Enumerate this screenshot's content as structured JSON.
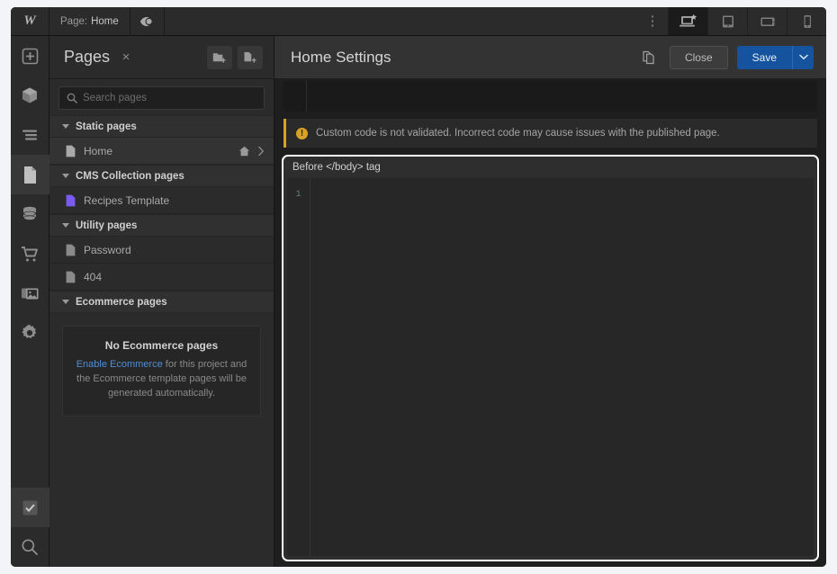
{
  "topbar": {
    "logo": "W",
    "page_prefix": "Page:",
    "page_name": "Home",
    "preview_icon": "eye-icon",
    "menu_icon": "three-dots-icon",
    "devices": [
      {
        "name": "desktop",
        "label": "Desktop",
        "active": true
      },
      {
        "name": "tablet",
        "label": "Tablet",
        "active": false
      },
      {
        "name": "tablet-landscape",
        "label": "Tablet landscape",
        "active": false
      },
      {
        "name": "mobile",
        "label": "Mobile",
        "active": false
      }
    ]
  },
  "rail": {
    "items": [
      {
        "name": "add-elements",
        "icon": "plus-box-icon",
        "selected": false
      },
      {
        "name": "components",
        "icon": "cube-icon",
        "selected": false
      },
      {
        "name": "navigator",
        "icon": "layers-lines-icon",
        "selected": false
      },
      {
        "name": "pages",
        "icon": "page-document-icon",
        "selected": true
      },
      {
        "name": "cms",
        "icon": "database-icon",
        "selected": false
      },
      {
        "name": "ecommerce",
        "icon": "shopping-cart-icon",
        "selected": false
      },
      {
        "name": "assets",
        "icon": "images-icon",
        "selected": false
      },
      {
        "name": "settings",
        "icon": "gear-icon",
        "selected": false
      }
    ],
    "bottom_items": [
      {
        "name": "audit",
        "icon": "checkbox-check-icon",
        "selected": true
      },
      {
        "name": "search",
        "icon": "magnifier-icon",
        "selected": false
      }
    ]
  },
  "pages_panel": {
    "title": "Pages",
    "close_label": "×",
    "new_folder_icon": "new-folder-icon",
    "new_page_icon": "new-page-icon",
    "search_placeholder": "Search pages",
    "search_value": "",
    "groups": [
      {
        "label": "Static pages",
        "items": [
          {
            "name": "Home",
            "icon": "page-icon",
            "active": true,
            "home": true,
            "chevron": true,
            "accent": "#a9a9a9"
          }
        ]
      },
      {
        "label": "CMS Collection pages",
        "items": [
          {
            "name": "Recipes Template",
            "icon": "page-icon",
            "active": false,
            "home": false,
            "chevron": false,
            "accent": "#7a5af0"
          }
        ]
      },
      {
        "label": "Utility pages",
        "items": [
          {
            "name": "Password",
            "icon": "page-icon",
            "active": false,
            "home": false,
            "chevron": false,
            "accent": "#8a8a8a"
          },
          {
            "name": "404",
            "icon": "page-icon",
            "active": false,
            "home": false,
            "chevron": false,
            "accent": "#8a8a8a"
          }
        ]
      },
      {
        "label": "Ecommerce pages",
        "items": []
      }
    ],
    "empty_state": {
      "title": "No Ecommerce pages",
      "link": "Enable Ecommerce",
      "text": " for this project and the Ecommerce template pages will be generated automatically."
    }
  },
  "main": {
    "title": "Home Settings",
    "duplicate_icon": "copy-pages-icon",
    "close_label": "Close",
    "save_label": "Save",
    "save_caret_icon": "chevron-down-icon",
    "warning": {
      "icon": "warning-circle-icon",
      "text": "Custom code is not validated. Incorrect code may cause issues with the published page."
    },
    "code_field": {
      "label": "Before </body> tag",
      "line_numbers": [
        "1"
      ],
      "value": "",
      "focused": true
    }
  },
  "colors": {
    "accent_blue": "#15539e",
    "warning_yellow": "#d9a227",
    "link_blue": "#4f8ed6",
    "cms_purple": "#7a5af0",
    "focus_ring": "#ffffff"
  }
}
